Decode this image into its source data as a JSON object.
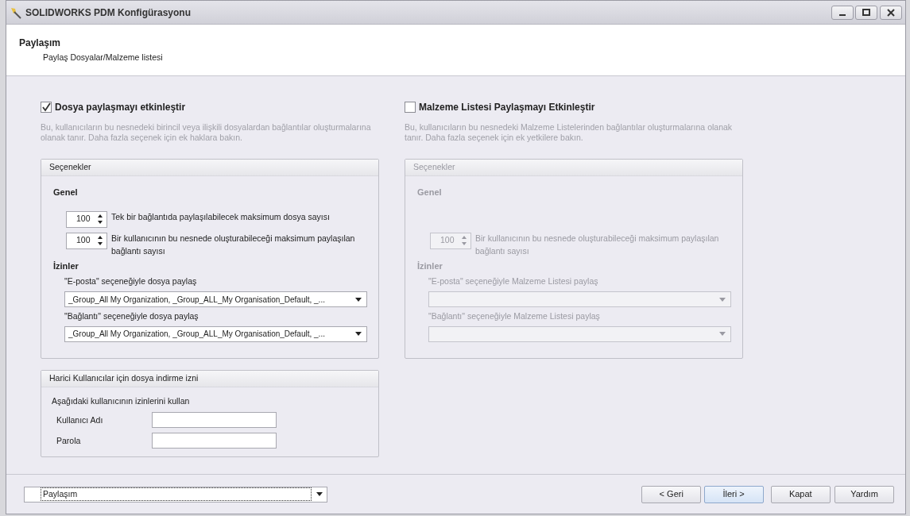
{
  "window": {
    "title": "SOLIDWORKS PDM Konfigürasyonu"
  },
  "header": {
    "title": "Paylaşım",
    "subtitle": "Paylaş Dosyalar/Malzeme listesi"
  },
  "sections": [
    {
      "label": "Dosya paylaşmayı etkinleştir",
      "checked": true,
      "description": "Bu, kullanıcıların bu nesnedeki birincil veya ilişkili dosyalardan bağlantılar oluşturmalarına olanak tanır. Daha fazla seçenek için ek haklara bakın.",
      "group": {
        "title": "Seçenekler",
        "general_heading": "Genel",
        "spinners": [
          {
            "value": "100",
            "label": "Tek bir bağlantıda paylaşılabilecek maksimum dosya sayısı"
          },
          {
            "value": "100",
            "label": "Bir kullanıcının bu nesnede oluşturabileceği maksimum paylaşılan bağlantı sayısı"
          }
        ],
        "permissions_heading": "İzinler",
        "permissions": [
          {
            "label": "\"E-posta\" seçeneğiyle dosya paylaş",
            "value": "_Group_All My Organization, _Group_ALL_My Organisation_Default, _..."
          },
          {
            "label": "\"Bağlantı\" seçeneğiyle dosya paylaş",
            "value": "_Group_All My Organization, _Group_ALL_My Organisation_Default, _..."
          }
        ]
      }
    },
    {
      "label": "Malzeme Listesi Paylaşmayı Etkinleştir",
      "checked": false,
      "description": "Bu, kullanıcıların bu nesnedeki Malzeme Listelerinden bağlantılar oluşturmalarına olanak tanır. Daha fazla seçenek için ek yetkilere bakın.",
      "group": {
        "title": "Seçenekler",
        "general_heading": "Genel",
        "spinners": [
          {
            "value": "100",
            "label": "Bir kullanıcının bu nesnede oluşturabileceği maksimum paylaşılan bağlantı sayısı"
          }
        ],
        "permissions_heading": "İzinler",
        "permissions": [
          {
            "label": "\"E-posta\" seçeneğiyle Malzeme Listesi paylaş"
          },
          {
            "label": "\"Bağlantı\" seçeneğiyle Malzeme Listesi paylaş"
          }
        ]
      }
    }
  ],
  "external": {
    "title": "Harici Kullanıcılar için dosya indirme izni",
    "intro": "Aşağıdaki kullanıcının izinlerini kullan",
    "fields": [
      {
        "label": "Kullanıcı Adı"
      },
      {
        "label": "Parola"
      }
    ]
  },
  "footer": {
    "page_select": "Paylaşım",
    "buttons": [
      {
        "label": "< Geri",
        "default": false
      },
      {
        "label": "İleri >",
        "default": true
      },
      {
        "label": "Kapat",
        "default": false
      },
      {
        "label": "Yardım",
        "default": false
      }
    ]
  }
}
